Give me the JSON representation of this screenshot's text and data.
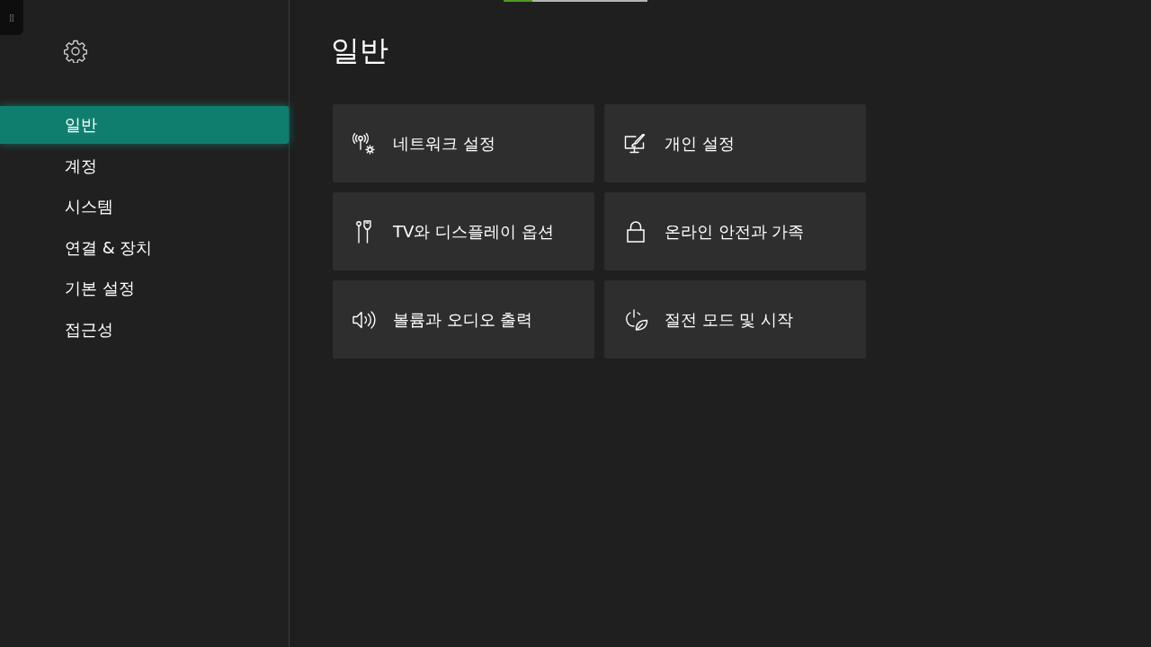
{
  "progress": {
    "level": 0.2
  },
  "sidebar": {
    "items": [
      {
        "label": "일반",
        "selected": true
      },
      {
        "label": "계정",
        "selected": false
      },
      {
        "label": "시스템",
        "selected": false
      },
      {
        "label": "연결 & 장치",
        "selected": false
      },
      {
        "label": "기본 설정",
        "selected": false
      },
      {
        "label": "접근성",
        "selected": false
      }
    ]
  },
  "page": {
    "title": "일반"
  },
  "tiles": [
    {
      "label": "네트워크 설정",
      "kind": "network"
    },
    {
      "label": "개인 설정",
      "kind": "personalize"
    },
    {
      "label": "TV와 디스플레이 옵션",
      "kind": "tv"
    },
    {
      "label": "온라인 안전과 가족",
      "kind": "lock"
    },
    {
      "label": "볼륨과 오디오 출력",
      "kind": "volume"
    },
    {
      "label": "절전 모드 및 시작",
      "kind": "power"
    }
  ]
}
